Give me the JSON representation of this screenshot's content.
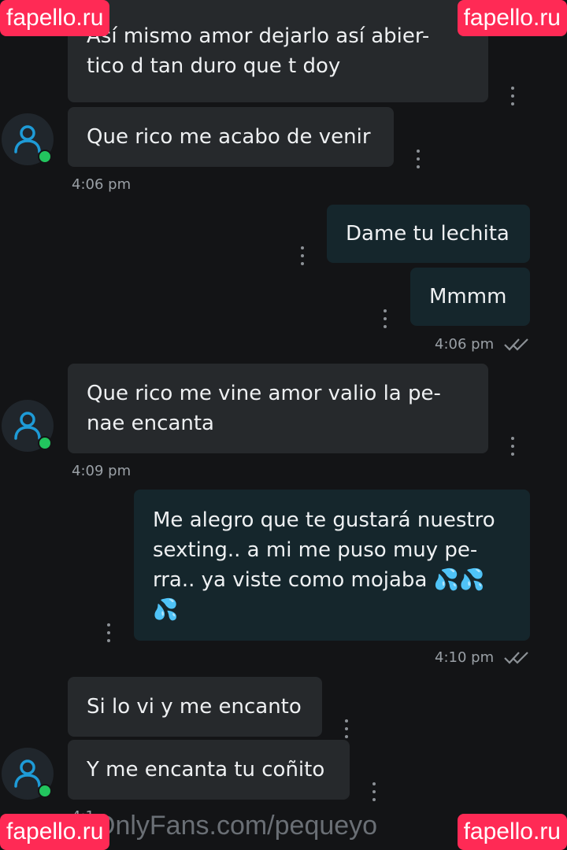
{
  "messages": [
    {
      "text": "Así mismo amor dejarlo así abier-\ntico d tan duro que t doy"
    },
    {
      "text": "Que rico me acabo de venir"
    },
    {
      "text": "Dame tu lechita"
    },
    {
      "text": "Mmmm"
    },
    {
      "text": "Que rico me vine amor valio la pe-\nnae encanta"
    },
    {
      "text": "Me alegro que te gustará nuestro\nsexting.. a mi me puso muy pe-\nrra.. ya viste como mojaba 💦💦\n💦"
    },
    {
      "text": "Si lo vi y me encanto"
    },
    {
      "text": "Y me encanta tu coñito"
    }
  ],
  "timestamps": [
    "4:06 pm",
    "4:06 pm",
    "4:09 pm",
    "4:10 pm",
    "4:1"
  ],
  "watermark": "fapello.ru",
  "footer_url": "OnlyFans.com/pequeyo",
  "colors": {
    "accent": "#ff2a55",
    "online": "#22c55e",
    "avatar": "#1e9bd7"
  }
}
